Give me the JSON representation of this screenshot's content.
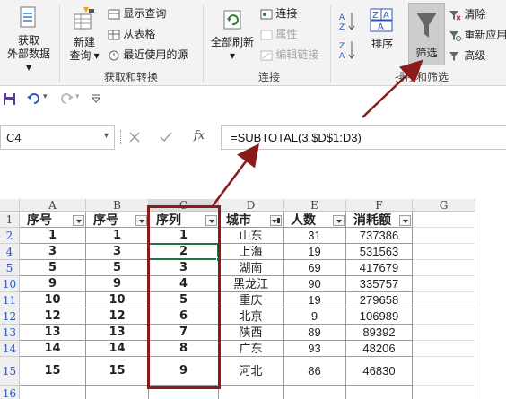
{
  "ribbon": {
    "get_external": {
      "line1": "获取",
      "line2": "外部数据"
    },
    "new_query": {
      "line1": "新建",
      "line2": "查询"
    },
    "show_queries": "显示查询",
    "from_table": "从表格",
    "recent_sources": "最近使用的源",
    "group_transform": "获取和转换",
    "refresh_all": "全部刷新",
    "connections": "连接",
    "properties": "属性",
    "edit_links": "编辑链接",
    "group_connections": "连接",
    "sort": "排序",
    "filter": "筛选",
    "clear": "清除",
    "reapply": "重新应用",
    "advanced": "高级",
    "group_sort_filter": "排序和筛选"
  },
  "formula_bar": {
    "name_box": "C4",
    "fx": "fx",
    "formula": "=SUBTOTAL(3,$D$1:D3)"
  },
  "columns": [
    "A",
    "B",
    "C",
    "D",
    "E",
    "F",
    "G"
  ],
  "row_numbers": [
    "1",
    "2",
    "4",
    "5",
    "10",
    "11",
    "12",
    "13",
    "14",
    "15",
    "16"
  ],
  "table": {
    "headers": [
      "序号",
      "序号",
      "序列",
      "城市",
      "人数",
      "消耗额"
    ],
    "rows": [
      [
        "1",
        "1",
        "1",
        "山东",
        "31",
        "737386"
      ],
      [
        "3",
        "3",
        "2",
        "上海",
        "19",
        "531563"
      ],
      [
        "5",
        "5",
        "3",
        "湖南",
        "69",
        "417679"
      ],
      [
        "9",
        "9",
        "4",
        "黑龙江",
        "90",
        "335757"
      ],
      [
        "10",
        "10",
        "5",
        "重庆",
        "19",
        "279658"
      ],
      [
        "12",
        "12",
        "6",
        "北京",
        "9",
        "106989"
      ],
      [
        "13",
        "13",
        "7",
        "陕西",
        "89",
        "89392"
      ],
      [
        "14",
        "14",
        "8",
        "广东",
        "93",
        "48206"
      ],
      [
        "15",
        "15",
        "9",
        "河北",
        "86",
        "46830"
      ]
    ]
  },
  "colors": {
    "accent_green": "#217346",
    "annotation_red": "#8b1a1a",
    "row_number_blue": "#2b56b8"
  }
}
